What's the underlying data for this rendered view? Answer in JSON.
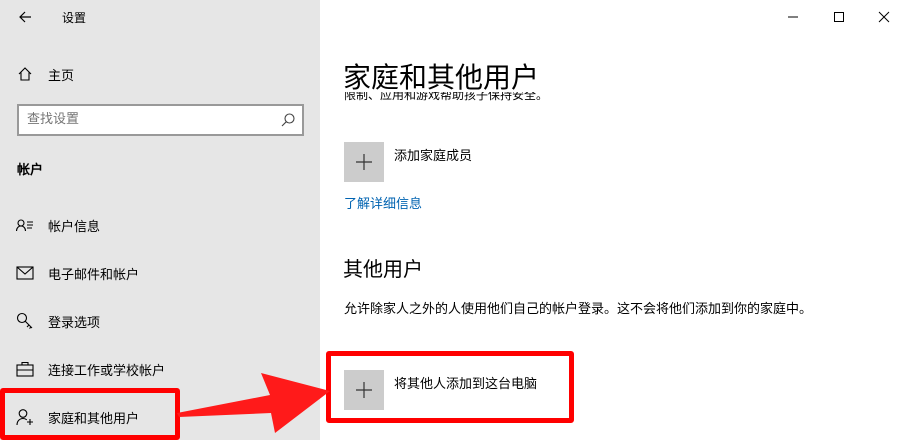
{
  "window": {
    "title": "设置",
    "controls": {
      "minimize": "—",
      "maximize": "☐",
      "close": "✕"
    }
  },
  "sidebar": {
    "home_label": "主页",
    "search_placeholder": "查找设置",
    "section": "帐户",
    "items": [
      {
        "label": "帐户信息",
        "icon": "account-info-icon"
      },
      {
        "label": "电子邮件和帐户",
        "icon": "mail-icon"
      },
      {
        "label": "登录选项",
        "icon": "key-icon"
      },
      {
        "label": "连接工作或学校帐户",
        "icon": "briefcase-icon"
      },
      {
        "label": "家庭和其他用户",
        "icon": "person-add-icon",
        "selected": true
      }
    ]
  },
  "main": {
    "title": "家庭和其他用户",
    "family_desc_cut": "限制、应用和游戏帮助孩子保持安全。",
    "add_family_label": "添加家庭成员",
    "learn_more": "了解详细信息",
    "other_users_title": "其他用户",
    "other_users_desc": "允许除家人之外的人使用他们自己的帐户登录。这不会将他们添加到你的家庭中。",
    "add_other_label": "将其他人添加到这台电脑"
  },
  "colors": {
    "sidebar_bg": "#e6e6e6",
    "link": "#0063b1",
    "accent": "#0078d7",
    "annotation": "#ff0000"
  }
}
